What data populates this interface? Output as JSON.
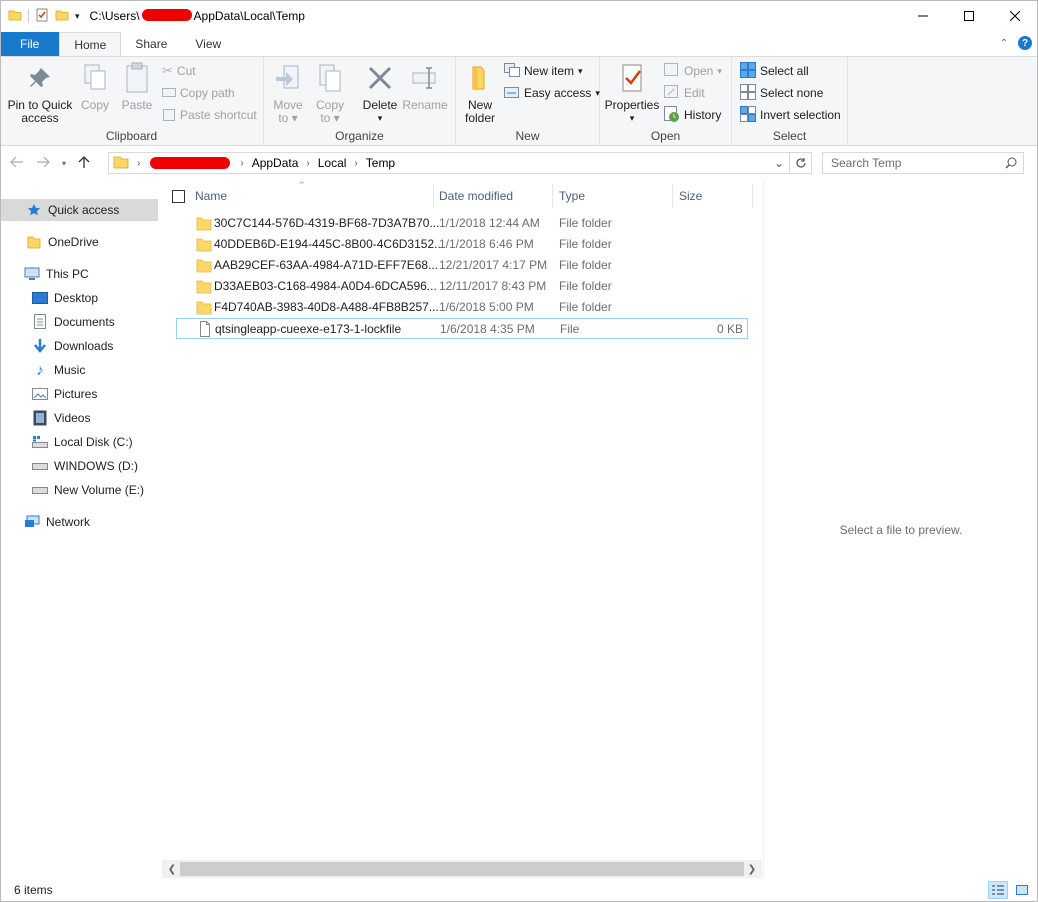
{
  "title": {
    "path_prefix": "C:\\Users\\",
    "path_suffix": "AppData\\Local\\Temp"
  },
  "tabs": {
    "file": "File",
    "home": "Home",
    "share": "Share",
    "view": "View"
  },
  "ribbon": {
    "clipboard": {
      "label": "Clipboard",
      "pin_line1": "Pin to Quick",
      "pin_line2": "access",
      "copy": "Copy",
      "paste": "Paste",
      "cut": "Cut",
      "copy_path": "Copy path",
      "paste_shortcut": "Paste shortcut"
    },
    "organize": {
      "label": "Organize",
      "move_line1": "Move",
      "move_line2": "to",
      "copy_line1": "Copy",
      "copy_line2": "to",
      "delete": "Delete",
      "rename": "Rename"
    },
    "new": {
      "label": "New",
      "folder_line1": "New",
      "folder_line2": "folder",
      "new_item": "New item",
      "easy_access": "Easy access"
    },
    "open": {
      "label": "Open",
      "properties": "Properties",
      "open": "Open",
      "edit": "Edit",
      "history": "History"
    },
    "select": {
      "label": "Select",
      "select_all": "Select all",
      "select_none": "Select none",
      "invert": "Invert selection"
    }
  },
  "address": {
    "crumbs": [
      "AppData",
      "Local",
      "Temp"
    ]
  },
  "search": {
    "placeholder": "Search Temp"
  },
  "nav": {
    "quick_access": "Quick access",
    "onedrive": "OneDrive",
    "this_pc": "This PC",
    "desktop": "Desktop",
    "documents": "Documents",
    "downloads": "Downloads",
    "music": "Music",
    "pictures": "Pictures",
    "videos": "Videos",
    "local_disk": "Local Disk (C:)",
    "windows_d": "WINDOWS (D:)",
    "new_volume": "New Volume (E:)",
    "network": "Network"
  },
  "columns": {
    "name": "Name",
    "date": "Date modified",
    "type": "Type",
    "size": "Size"
  },
  "files": [
    {
      "name": "30C7C144-576D-4319-BF68-7D3A7B70...",
      "date": "1/1/2018 12:44 AM",
      "type": "File folder",
      "size": "",
      "kind": "folder"
    },
    {
      "name": "40DDEB6D-E194-445C-8B00-4C6D3152...",
      "date": "1/1/2018 6:46 PM",
      "type": "File folder",
      "size": "",
      "kind": "folder"
    },
    {
      "name": "AAB29CEF-63AA-4984-A71D-EFF7E68...",
      "date": "12/21/2017 4:17 PM",
      "type": "File folder",
      "size": "",
      "kind": "folder"
    },
    {
      "name": "D33AEB03-C168-4984-A0D4-6DCA596...",
      "date": "12/11/2017 8:43 PM",
      "type": "File folder",
      "size": "",
      "kind": "folder"
    },
    {
      "name": "F4D740AB-3983-40D8-A488-4FB8B257...",
      "date": "1/6/2018 5:00 PM",
      "type": "File folder",
      "size": "",
      "kind": "folder"
    },
    {
      "name": "qtsingleapp-cueexe-e173-1-lockfile",
      "date": "1/6/2018 4:35 PM",
      "type": "File",
      "size": "0 KB",
      "kind": "file"
    }
  ],
  "preview": {
    "text": "Select a file to preview."
  },
  "status": {
    "items": "6 items"
  },
  "colors": {
    "accent": "#1979ca",
    "folder": "#ffd766",
    "selection": "#cce8ff",
    "redaction": "#e00000"
  }
}
